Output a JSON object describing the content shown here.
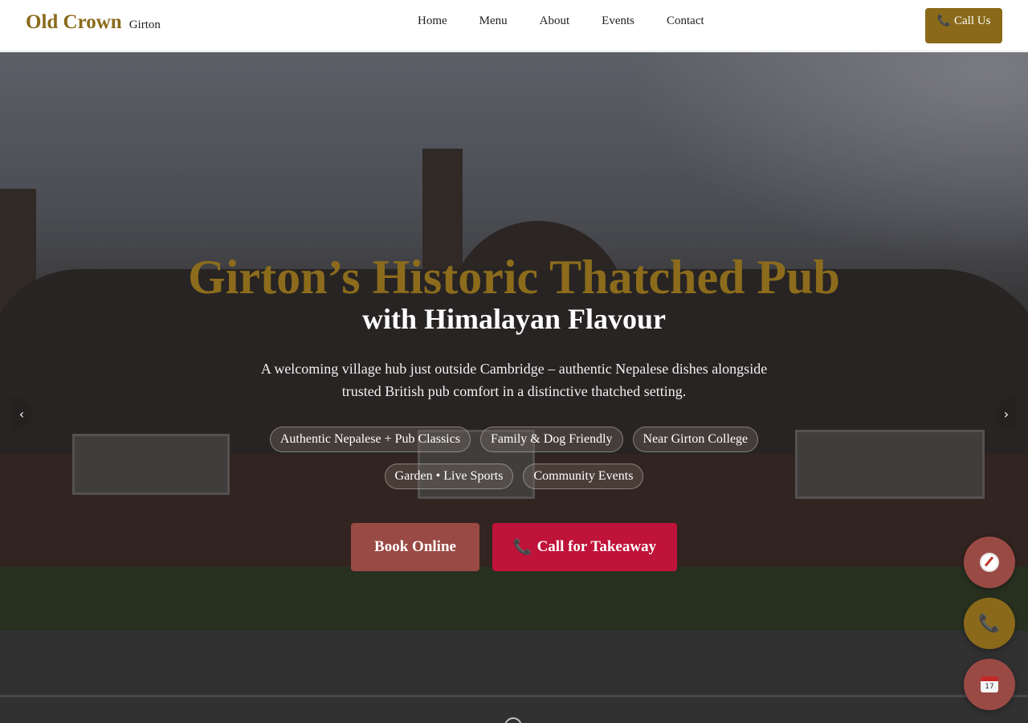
{
  "header": {
    "brand_name": "Old Crown",
    "brand_sub": "Girton",
    "nav": [
      {
        "label": "Home"
      },
      {
        "label": "Menu"
      },
      {
        "label": "About"
      },
      {
        "label": "Events"
      },
      {
        "label": "Contact"
      }
    ],
    "call_button": "Call Us",
    "call_icon": "phone-icon"
  },
  "hero": {
    "title": "Girton’s Historic Thatched Pub",
    "subtitle": "with Himalayan Flavour",
    "description": "A welcoming village hub just outside Cambridge – authentic Nepalese dishes alongside trusted British pub comfort in a distinctive thatched setting.",
    "chips_row1": [
      "Authentic Nepalese + Pub Classics",
      "Family & Dog Friendly",
      "Near Girton College"
    ],
    "chips_row2": [
      "Garden • Live Sports",
      "Community Events"
    ],
    "book_button": "Book Online",
    "takeaway_button": "Call for Takeaway",
    "prev_arrow": "‹",
    "next_arrow": "›"
  },
  "fabs": {
    "directions_icon": "compass-icon",
    "call_icon": "phone-icon",
    "booking_icon": "calendar-icon",
    "calendar_day": "17"
  },
  "colors": {
    "brand_gold": "#8a6a1a",
    "book_red": "#9a4a44",
    "takeaway_red": "#c0133a"
  }
}
